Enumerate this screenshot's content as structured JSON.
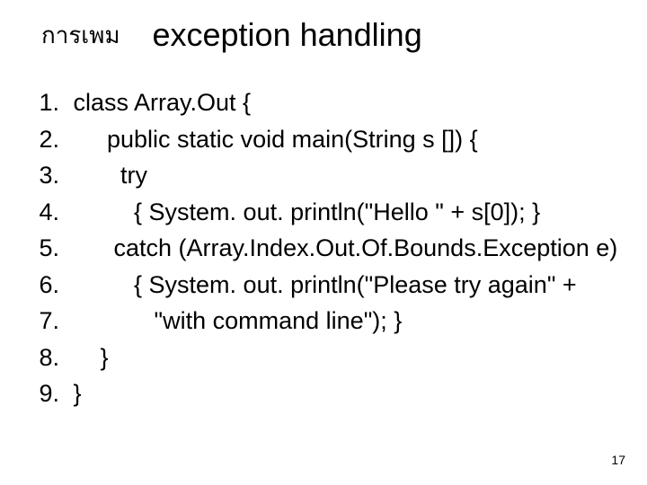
{
  "title_thai": "การเพม",
  "title_eng": "exception handling",
  "lines": {
    "0": {
      "num": "1.",
      "text": " class Array.Out {"
    },
    "1": {
      "num": "2.",
      "text": "      public static void main(String s []) {"
    },
    "2": {
      "num": "3.",
      "text": "        try"
    },
    "3": {
      "num": "4.",
      "text": "          { System. out. println(\"Hello \" + s[0]); }"
    },
    "4": {
      "num": "5.",
      "text": "       catch (Array.Index.Out.Of.Bounds.Exception e)"
    },
    "5": {
      "num": "6.",
      "text": "          { System. out. println(\"Please try again\" +"
    },
    "6": {
      "num": "7.",
      "text": "             \"with command line\"); }"
    },
    "7": {
      "num": "8.",
      "text": "     }"
    },
    "8": {
      "num": "9.",
      "text": " }"
    }
  },
  "page_number": "17"
}
